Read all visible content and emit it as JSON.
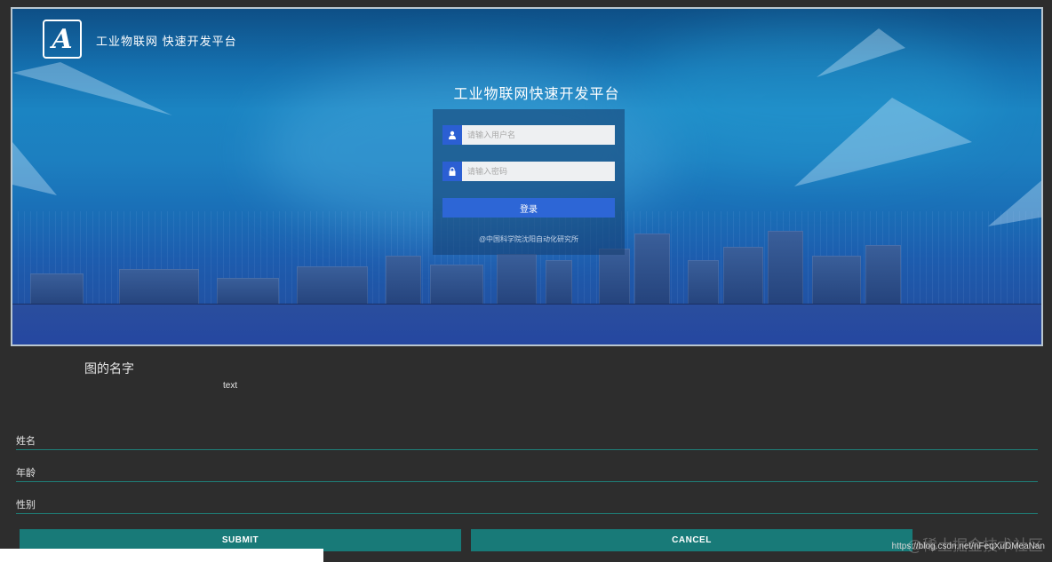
{
  "banner": {
    "brand": "工业物联网  快速开发平台",
    "login": {
      "title": "工业物联网快速开发平台",
      "username_placeholder": "请输入用户名",
      "password_placeholder": "请输入密码",
      "username_icon": "user-icon",
      "password_icon": "lock-icon",
      "login_label": "登录",
      "copyright": "@中国科学院沈阳自动化研究所"
    }
  },
  "figure": {
    "caption": "图的名字",
    "text": "text"
  },
  "form": {
    "fields": [
      {
        "label": "姓名",
        "value": ""
      },
      {
        "label": "年龄",
        "value": ""
      },
      {
        "label": "性别",
        "value": ""
      }
    ],
    "submit_label": "SUBMIT",
    "cancel_label": "CANCEL"
  },
  "watermark": {
    "url": "https://blog.csdn.net/nFeqXuDMeaNan",
    "cn": "@稀土掘金技术社区"
  },
  "colors": {
    "background": "#2d2d2d",
    "accent": "#187a78",
    "login_button": "#2d66d6"
  }
}
